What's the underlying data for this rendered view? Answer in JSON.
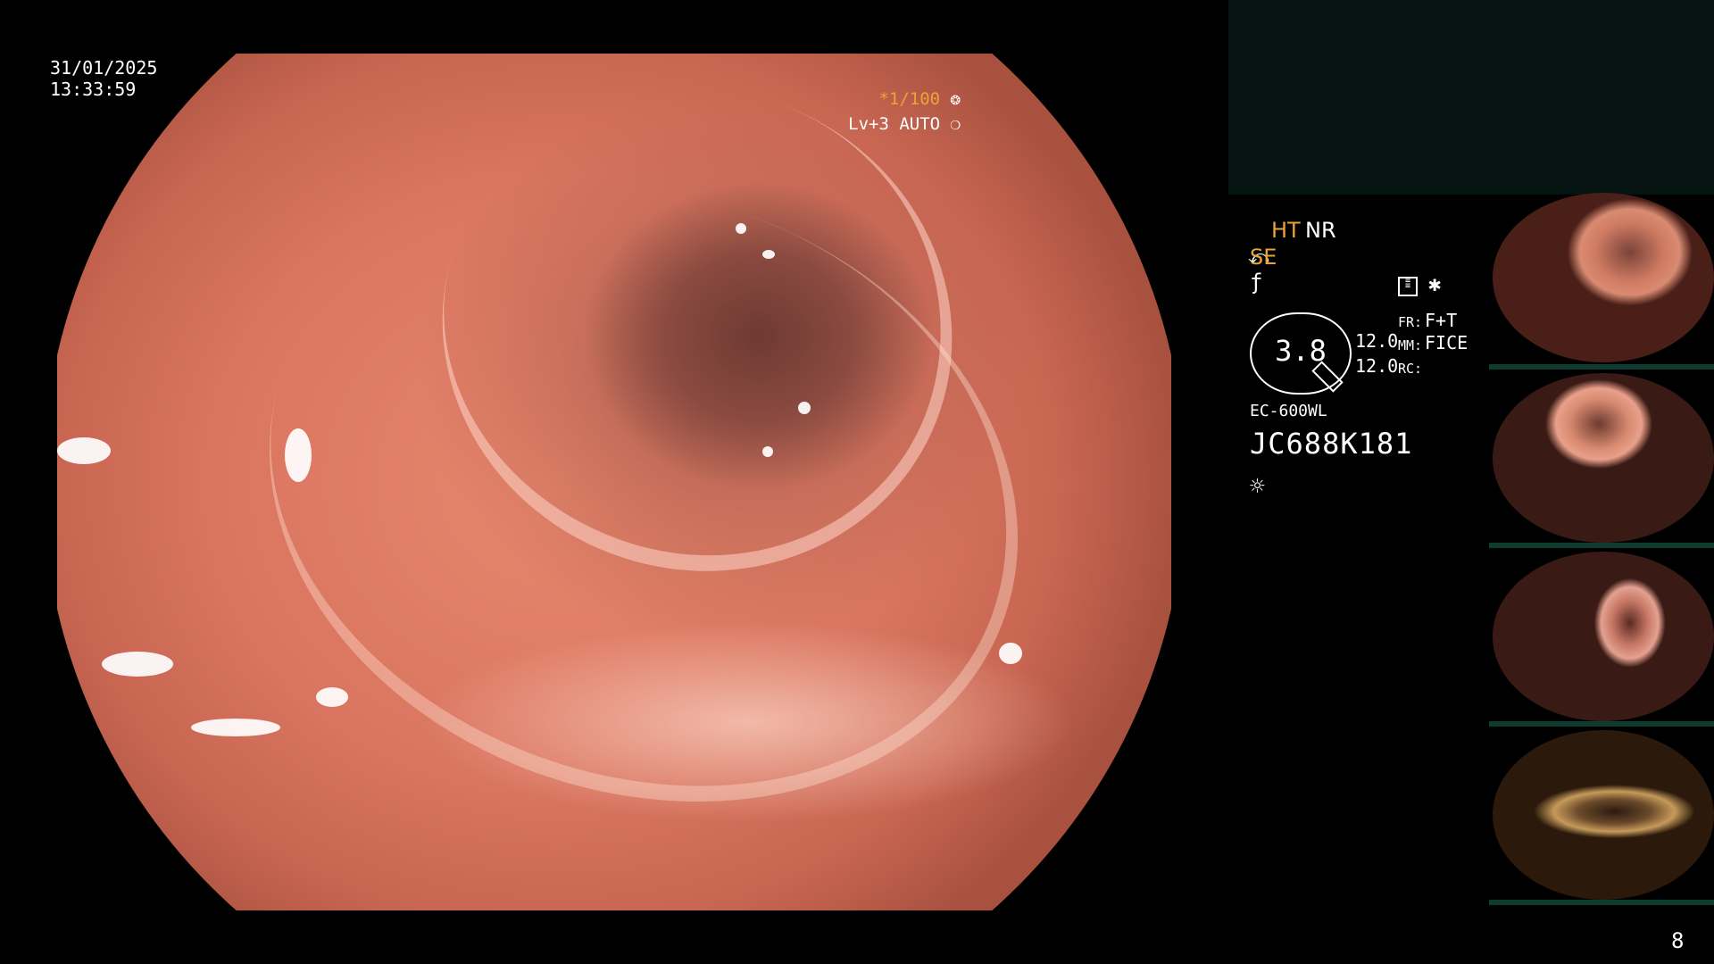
{
  "overlay": {
    "date": "31/01/2025",
    "time": "13:33:59",
    "shutter": "*1/100",
    "level": "Lv+3 AUTO",
    "page_number": "8"
  },
  "settings": {
    "ht": "HT",
    "nr": "NR",
    "se": "SE",
    "zoom": "3.8",
    "values": [
      "12.0",
      "12.0"
    ],
    "labels": [
      {
        "key": "FR:",
        "value": "F+T"
      },
      {
        "key": "MM:",
        "value": "FICE"
      },
      {
        "key": "RC:",
        "value": ""
      }
    ],
    "model": "EC-600WL",
    "serial": "JC688K181"
  },
  "colors": {
    "accent": "#e9a33a",
    "panel": "#051411",
    "thumb_bar": "#0e3a2f"
  },
  "icons": [
    "scope-icon",
    "freeze-icon",
    "memo-icon",
    "asterisk-icon",
    "brightness-icon",
    "pencil-icon"
  ]
}
